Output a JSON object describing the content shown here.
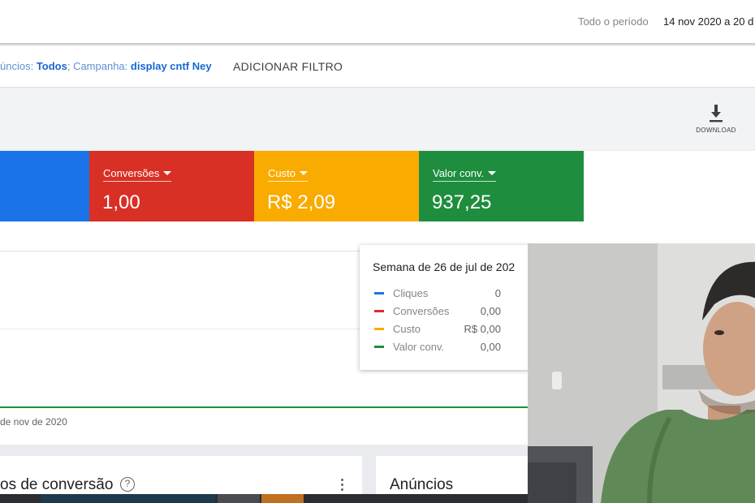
{
  "header": {
    "period_label": "Todo o período",
    "period_value": "14 nov 2020 a 20 d"
  },
  "filters": {
    "ads_prefix": "úncios: ",
    "ads_value": "Todos",
    "campaign_prefix": "; Campanha: ",
    "campaign_value": "display cntf Ney",
    "add_filter": "ADICIONAR FILTRO"
  },
  "toolbar": {
    "download_label": "DOWNLOAD",
    "download_icon": "download-icon"
  },
  "scorecards": [
    {
      "name": "",
      "value": "",
      "color": "#1a73e8"
    },
    {
      "name": "Conversões",
      "value": "1,00",
      "color": "#d93025"
    },
    {
      "name": "Custo",
      "value": "R$ 2,09",
      "color": "#f9ab00"
    },
    {
      "name": "Valor conv.",
      "value": "937,25",
      "color": "#1e8e3e"
    }
  ],
  "chart": {
    "x_axis_label": "de nov de 2020"
  },
  "tooltip": {
    "title": "Semana de 26 de jul de 202",
    "rows": [
      {
        "label": "Cliques",
        "value": "0",
        "color": "#1a73e8"
      },
      {
        "label": "Conversões",
        "value": "0,00",
        "color": "#d93025"
      },
      {
        "label": "Custo",
        "value": "R$ 0,00",
        "color": "#f9ab00"
      },
      {
        "label": "Valor conv.",
        "value": "0,00",
        "color": "#1e8e3e"
      }
    ]
  },
  "sections": {
    "conversion_title": "os de conversão",
    "conversion_help_icon": "help-circle-icon",
    "conversion_more_icon": "more-vert-icon",
    "ads_title": "Anúncios"
  },
  "webcam": {
    "description_icon": "webcam-video-overlay"
  }
}
